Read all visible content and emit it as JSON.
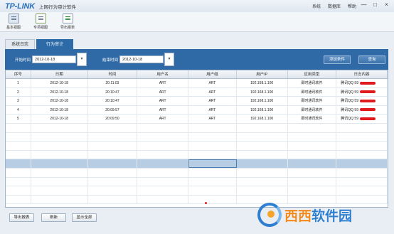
{
  "app": {
    "logo": "TP-LINK",
    "title": "上网行为审计软件",
    "menu": [
      "系统",
      "数据库",
      "帮助"
    ],
    "controls": [
      "—",
      "□",
      "×"
    ]
  },
  "toolbar": {
    "items": [
      {
        "label": "基本视图",
        "icon": "basic-view-icon"
      },
      {
        "label": "专项视图",
        "icon": "custom-view-icon"
      },
      {
        "label": "导出报表",
        "icon": "export-report-icon"
      }
    ]
  },
  "tabs": [
    {
      "label": "系统日志",
      "active": false
    },
    {
      "label": "行为审计",
      "active": true
    }
  ],
  "filter": {
    "start_label": "开始时间",
    "start_value": "2012-10-18",
    "end_label": "结束时间",
    "end_value": "2012-10-18",
    "add_condition": "添加条件",
    "query": "查询"
  },
  "table": {
    "columns": [
      "序号",
      "日期",
      "时间",
      "用户名",
      "用户组",
      "用户IP",
      "应用类型",
      "日志内容"
    ],
    "rows": [
      [
        "1",
        "2012-10-18",
        "20:11:03",
        "ART",
        "ART",
        "192.168.1.100",
        "即时通讯软件",
        "腾讯QQ 59"
      ],
      [
        "2",
        "2012-10-18",
        "20:10:47",
        "ART",
        "ART",
        "192.168.1.100",
        "即时通讯软件",
        "腾讯QQ 59"
      ],
      [
        "3",
        "2012-10-18",
        "20:10:47",
        "ART",
        "ART",
        "192.168.1.100",
        "即时通讯软件",
        "腾讯QQ 59"
      ],
      [
        "4",
        "2012-10-18",
        "20:09:57",
        "ART",
        "ART",
        "192.168.1.100",
        "即时通讯软件",
        "腾讯QQ 59"
      ],
      [
        "5",
        "2012-10-18",
        "20:09:50",
        "ART",
        "ART",
        "192.168.1.100",
        "即时通讯软件",
        "腾讯QQ 59"
      ]
    ]
  },
  "buttons": {
    "export": "导出报表",
    "refresh": "刷新",
    "show_all": "显示全部"
  },
  "watermark": {
    "text_hot": "西西",
    "text_rest": "软件园"
  },
  "colors": {
    "accent": "#2f6aa6",
    "selected_row": "#b7cde4",
    "redaction": "#e0191f"
  }
}
